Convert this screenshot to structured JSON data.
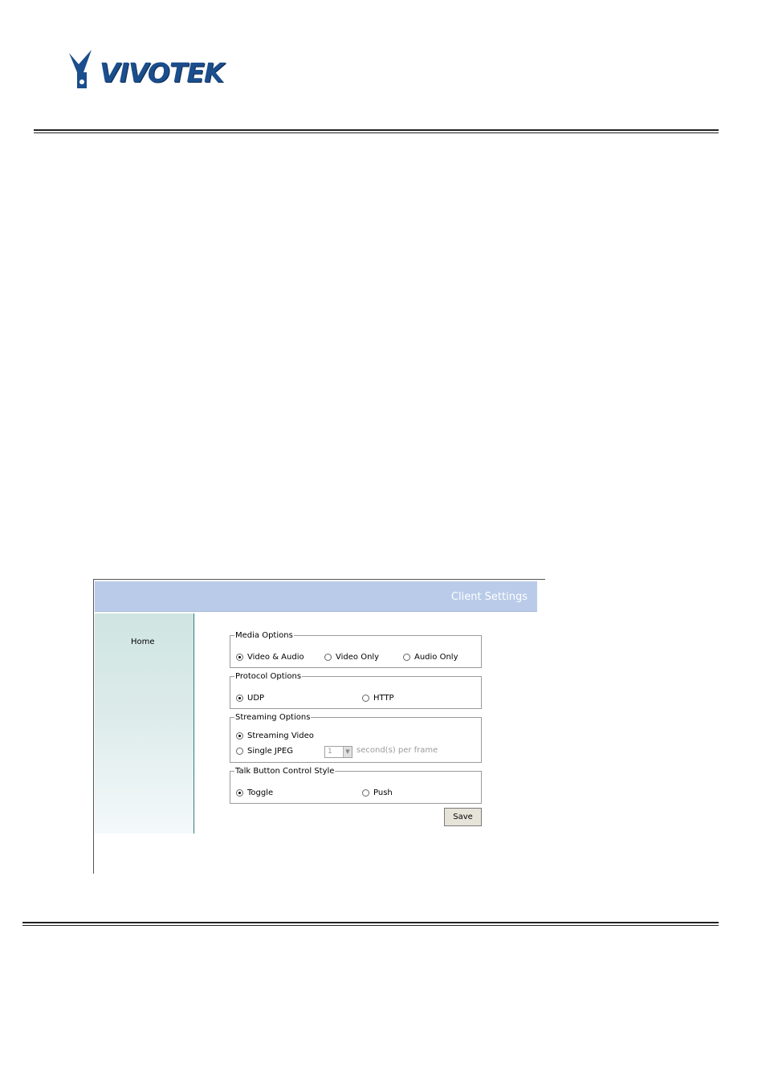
{
  "brand": {
    "logo_text": "VIVOTEK",
    "color": "#1b4e8c"
  },
  "app": {
    "title": "Client Settings"
  },
  "sidebar": {
    "home_label": "Home"
  },
  "media_options": {
    "legend": "Media Options",
    "options": [
      "Video & Audio",
      "Video Only",
      "Audio Only"
    ],
    "selected": "Video & Audio"
  },
  "protocol_options": {
    "legend": "Protocol Options",
    "options": [
      "UDP",
      "HTTP"
    ],
    "selected": "UDP"
  },
  "streaming_options": {
    "legend": "Streaming Options",
    "options": [
      "Streaming Video",
      "Single JPEG"
    ],
    "selected": "Streaming Video",
    "interval_value": "1",
    "interval_unit": "second(s) per frame"
  },
  "talk_options": {
    "legend": "Talk Button Control Style",
    "options": [
      "Toggle",
      "Push"
    ],
    "selected": "Toggle"
  },
  "save_label": "Save",
  "colors": {
    "header_bar": "#b9cbe9",
    "sidebar_border": "#2f7e84"
  }
}
